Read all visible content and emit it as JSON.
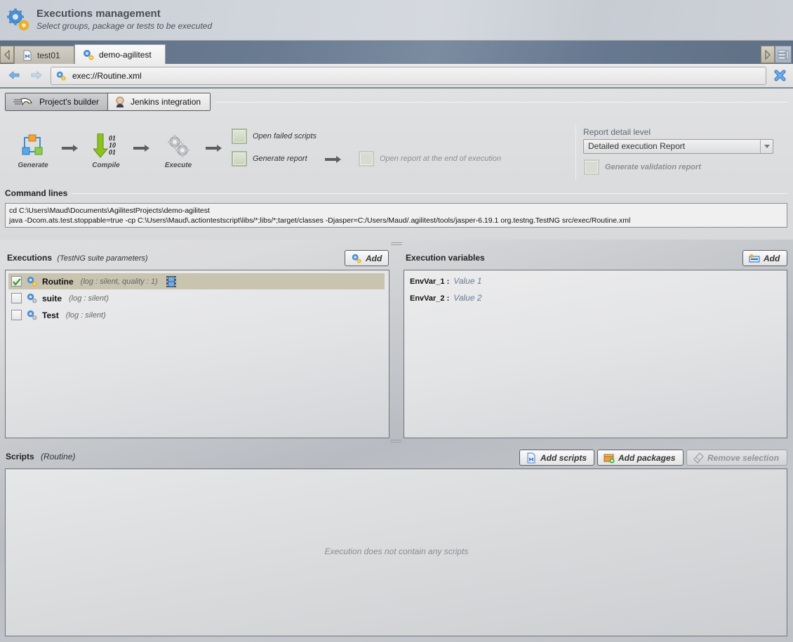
{
  "header": {
    "title": "Executions management",
    "subtitle": "Select groups, package or tests to be executed",
    "icon": "gears-icon"
  },
  "tabs": [
    {
      "label": "test01",
      "icon": "script-file-icon",
      "active": false
    },
    {
      "label": "demo-agilitest",
      "icon": "gears-icon",
      "active": true
    }
  ],
  "address": {
    "url": "exec://Routine.xml",
    "back_icon": "arrow-left-icon",
    "forward_icon": "arrow-right-icon",
    "close_icon": "close-icon"
  },
  "mode_toggle": {
    "builder_label": "Project's builder",
    "jenkins_label": "Jenkins integration",
    "active": "builder"
  },
  "pipeline": {
    "steps": [
      {
        "label": "Generate",
        "icon": "cubes-icon"
      },
      {
        "label": "Compile",
        "icon": "compile-icon"
      },
      {
        "label": "Execute",
        "icon": "gears-icon"
      }
    ],
    "options": {
      "open_failed_scripts": {
        "label": "Open failed scripts",
        "checked": false
      },
      "generate_report": {
        "label": "Generate report",
        "checked": false
      },
      "open_report_end": {
        "label": "Open  report at the end of execution",
        "checked": false,
        "enabled": false
      }
    }
  },
  "report": {
    "title": "Report detail level",
    "selected": "Detailed execution Report",
    "validation_label": "Generate validation report",
    "validation_checked": false
  },
  "command_lines": {
    "title": "Command lines",
    "lines": [
      "cd C:\\Users\\Maud\\Documents\\AgilitestProjects\\demo-agilitest",
      "java -Dcom.ats.test.stoppable=true -cp C:\\Users\\Maud\\.actiontestscript\\libs/*;libs/*;target/classes -Djasper=C:/Users/Maud/.agilitest/tools/jasper-6.19.1 org.testng.TestNG src/exec/Routine.xml"
    ]
  },
  "executions": {
    "title": "Executions",
    "subtitle": "(TestNG suite parameters)",
    "add_label": "Add",
    "items": [
      {
        "name": "Routine",
        "params": "(log : silent, quality : 1)",
        "checked": true,
        "selected": true,
        "has_video": true
      },
      {
        "name": "suite",
        "params": "(log : silent)",
        "checked": false,
        "selected": false,
        "has_video": false
      },
      {
        "name": "Test",
        "params": "(log : silent)",
        "checked": false,
        "selected": false,
        "has_video": false
      }
    ]
  },
  "variables": {
    "title": "Execution variables",
    "add_label": "Add",
    "items": [
      {
        "key": "EnvVar_1 :",
        "value": "Value 1"
      },
      {
        "key": "EnvVar_2 :",
        "value": "Value 2"
      }
    ]
  },
  "scripts": {
    "title": "Scripts",
    "subtitle": "(Routine)",
    "add_scripts_label": "Add scripts",
    "add_packages_label": "Add packages",
    "remove_label": "Remove selection",
    "empty_message": "Execution does not contain any scripts"
  }
}
